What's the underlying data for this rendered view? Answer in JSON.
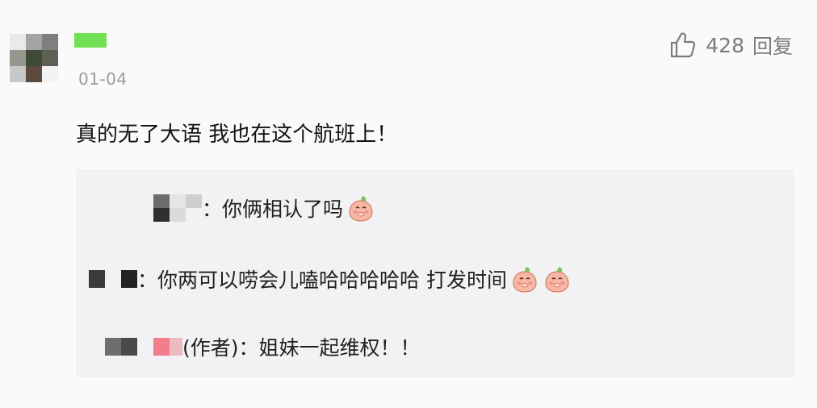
{
  "comment": {
    "date": "01-04",
    "likes": "428",
    "reply_label": "回复",
    "text": "真的无了大语 我也在这个航班上！"
  },
  "replies": [
    {
      "separator": "：",
      "text": "你俩相认了吗",
      "emoji": [
        "peach-cover-mouth-emoji"
      ]
    },
    {
      "separator": "：",
      "text": "你两可以唠会儿嗑哈哈哈哈哈 打发时间",
      "emoji": [
        "peach-cover-mouth-emoji",
        "peach-cover-mouth-emoji"
      ]
    },
    {
      "author_tag": "(作者)",
      "separator": "：",
      "text": "姐妹一起维权！！",
      "emoji": []
    }
  ],
  "colors": {
    "background": "#fafafa",
    "reply_box": "#f2f2f4",
    "username_mosaic": "#71e053",
    "meta_gray": "#9b9b9b",
    "author_mosaic_pink": "#f27d8c"
  },
  "icons": {
    "like": "thumbs-up-outline-icon",
    "emoji": "peach-cover-mouth-emoji"
  }
}
